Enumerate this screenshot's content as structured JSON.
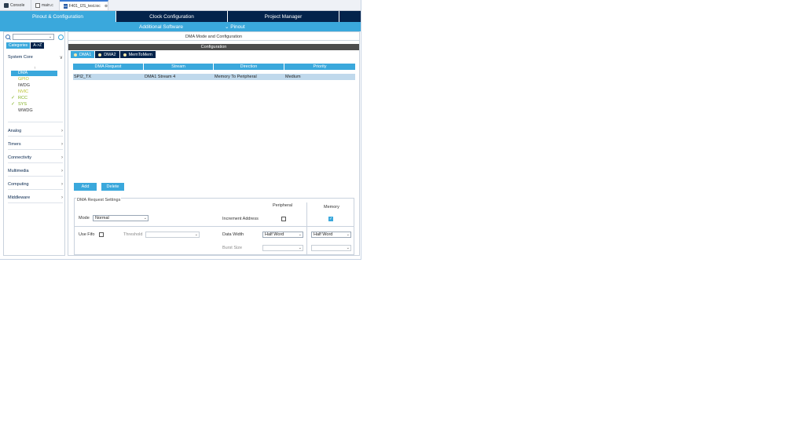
{
  "editor_tabs": [
    {
      "label": "Console",
      "icon": "console-icon"
    },
    {
      "label": "main.c",
      "icon": "c-file-icon"
    },
    {
      "label": "F401_I2S_test.ioc",
      "icon": "ioc-file-icon",
      "close": "⊗"
    }
  ],
  "nav": {
    "pinout": "Pinout & Configuration",
    "clock": "Clock Configuration",
    "project": "Project Manager"
  },
  "subnav": {
    "additional": "Additional Software",
    "pinout": "Pinout",
    "pinout_chevron": "⌄"
  },
  "left": {
    "category_tabs": [
      "Categories",
      "A->Z"
    ],
    "sort_arrow": "↑",
    "sections": {
      "system_core": "System Core",
      "analog": "Analog",
      "timers": "Timers",
      "connectivity": "Connectivity",
      "multimedia": "Multimedia",
      "computing": "Computing",
      "middleware": "Middleware"
    },
    "expanded_chevron": "∨",
    "collapsed_chevron": "›",
    "system_core_items": [
      {
        "label": "DMA",
        "check": ""
      },
      {
        "label": "GPIO",
        "check": ""
      },
      {
        "label": "IWDG",
        "check": ""
      },
      {
        "label": "NVIC",
        "check": ""
      },
      {
        "label": "RCC",
        "check": "✓"
      },
      {
        "label": "SYS",
        "check": "✓"
      },
      {
        "label": "WWDG",
        "check": ""
      }
    ]
  },
  "right": {
    "title": "DMA Mode and Configuration",
    "config_bar": "Configuration",
    "dma_tabs": [
      "DMA1",
      "DMA2",
      "MemToMem"
    ],
    "table": {
      "headers": [
        "DMA Request",
        "Stream",
        "Direction",
        "Priority"
      ],
      "rows": [
        [
          "SPI2_TX",
          "DMA1 Stream 4",
          "Memory To Peripheral",
          "Medium"
        ]
      ]
    },
    "buttons": {
      "add": "Add",
      "delete": "Delete"
    },
    "settings": {
      "title": "DMA Request Settings",
      "mode_label": "Mode",
      "mode_value": "Normal",
      "use_fifo_label": "Use Fifo",
      "threshold_label": "Threshold",
      "threshold_value": "",
      "peripheral_header": "Peripheral",
      "memory_header": "Memory",
      "increment_label": "Increment Address",
      "increment_peripheral": false,
      "increment_memory": true,
      "data_width_label": "Data Width",
      "data_width_peripheral": "Half Word",
      "data_width_memory": "Half Word",
      "burst_label": "Burst Size",
      "burst_peripheral": "",
      "burst_memory": "",
      "dropdown_arrow": "⌄",
      "check_mark": "✓"
    }
  },
  "colors": {
    "accent": "#3aa8dc",
    "navy": "#03234b",
    "check_green": "#80b020"
  }
}
